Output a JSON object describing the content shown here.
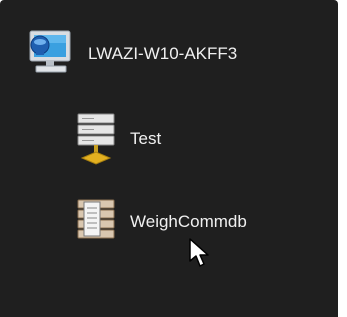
{
  "tree": {
    "server": {
      "label": "LWAZI-W10-AKFF3",
      "icon": "computer-monitor-icon"
    },
    "databases": [
      {
        "label": "Test",
        "icon": "database-server-icon"
      },
      {
        "label": "WeighCommdb",
        "icon": "database-document-icon"
      }
    ]
  },
  "colors": {
    "panel_background": "#1f1f1f",
    "text": "#f0f0f0",
    "monitor_screen": "#3aa0e0",
    "database_connector": "#e3b020"
  },
  "cursor": {
    "icon": "mouse-pointer-icon"
  }
}
